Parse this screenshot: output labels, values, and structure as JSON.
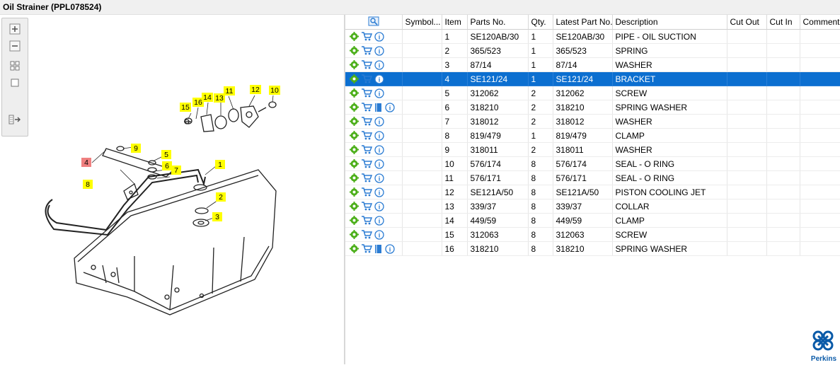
{
  "window": {
    "title": "Oil Strainer (PPL078524)"
  },
  "toolbar": {
    "icons": [
      "zoom-in-icon",
      "zoom-out-icon",
      "fit-grid-icon",
      "fit-page-icon",
      "list-export-icon"
    ]
  },
  "diagram": {
    "callouts": [
      "1",
      "2",
      "3",
      "4",
      "5",
      "6",
      "7",
      "8",
      "9",
      "10",
      "11",
      "12",
      "13",
      "14",
      "15",
      "16"
    ],
    "highlighted_callout": "4",
    "highlight_color": "#f08080",
    "callout_color": "#ffff00"
  },
  "grid": {
    "columns": [
      "",
      "Symbol...",
      "Item",
      "Parts No.",
      "Qty.",
      "Latest Part No.",
      "Description",
      "Cut Out",
      "Cut In",
      "Comment"
    ],
    "selected_row_color": "#0c6fd0",
    "rows": [
      {
        "item": "1",
        "part": "SE120AB/30",
        "qty": "1",
        "latest": "SE120AB/30",
        "desc": "PIPE - OIL SUCTION",
        "book": false
      },
      {
        "item": "2",
        "part": "365/523",
        "qty": "1",
        "latest": "365/523",
        "desc": "SPRING",
        "book": false
      },
      {
        "item": "3",
        "part": "87/14",
        "qty": "1",
        "latest": "87/14",
        "desc": "WASHER",
        "book": false
      },
      {
        "item": "4",
        "part": "SE121/24",
        "qty": "1",
        "latest": "SE121/24",
        "desc": "BRACKET",
        "book": false,
        "selected": true
      },
      {
        "item": "5",
        "part": "312062",
        "qty": "2",
        "latest": "312062",
        "desc": "SCREW",
        "book": false
      },
      {
        "item": "6",
        "part": "318210",
        "qty": "2",
        "latest": "318210",
        "desc": "SPRING WASHER",
        "book": true
      },
      {
        "item": "7",
        "part": "318012",
        "qty": "2",
        "latest": "318012",
        "desc": "WASHER",
        "book": false
      },
      {
        "item": "8",
        "part": "819/479",
        "qty": "1",
        "latest": "819/479",
        "desc": "CLAMP",
        "book": false
      },
      {
        "item": "9",
        "part": "318011",
        "qty": "2",
        "latest": "318011",
        "desc": "WASHER",
        "book": false
      },
      {
        "item": "10",
        "part": "576/174",
        "qty": "8",
        "latest": "576/174",
        "desc": "SEAL - O RING",
        "book": false
      },
      {
        "item": "11",
        "part": "576/171",
        "qty": "8",
        "latest": "576/171",
        "desc": "SEAL - O RING",
        "book": false
      },
      {
        "item": "12",
        "part": "SE121A/50",
        "qty": "8",
        "latest": "SE121A/50",
        "desc": "PISTON COOLING JET",
        "book": false
      },
      {
        "item": "13",
        "part": "339/37",
        "qty": "8",
        "latest": "339/37",
        "desc": "COLLAR",
        "book": false
      },
      {
        "item": "14",
        "part": "449/59",
        "qty": "8",
        "latest": "449/59",
        "desc": "CLAMP",
        "book": false
      },
      {
        "item": "15",
        "part": "312063",
        "qty": "8",
        "latest": "312063",
        "desc": "SCREW",
        "book": false
      },
      {
        "item": "16",
        "part": "318210",
        "qty": "8",
        "latest": "318210",
        "desc": "SPRING WASHER",
        "book": true
      }
    ]
  },
  "brand": {
    "name": "Perkins",
    "color": "#0a5aa8"
  }
}
